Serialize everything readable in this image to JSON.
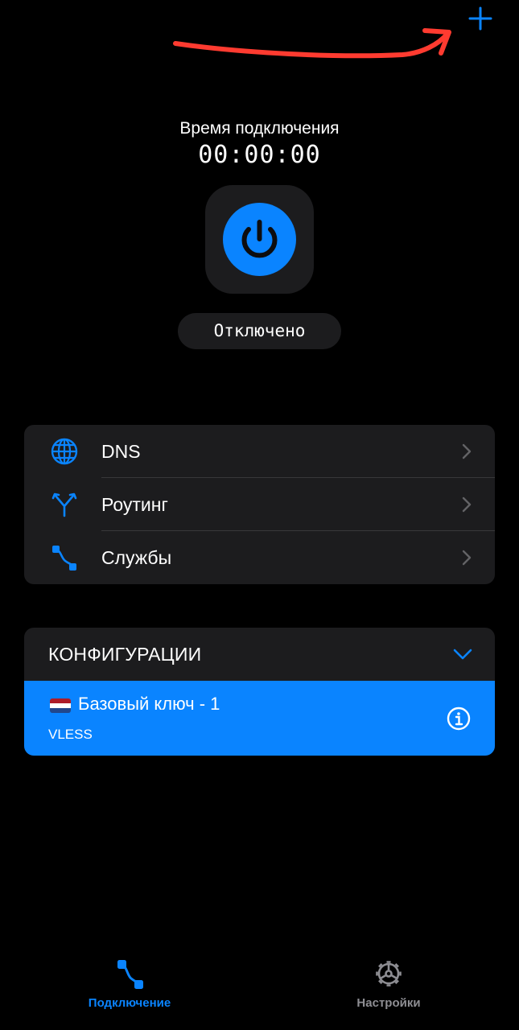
{
  "toolbar": {
    "add_icon": "plus-icon"
  },
  "connection": {
    "timer_label": "Время подключения",
    "timer_value": "00:00:00",
    "power_icon": "power-icon",
    "status": "Отключено"
  },
  "menu": {
    "items": [
      {
        "label": "DNS",
        "icon": "globe-icon"
      },
      {
        "label": "Роутинг",
        "icon": "routing-fork-icon"
      },
      {
        "label": "Службы",
        "icon": "services-node-icon"
      }
    ]
  },
  "configs": {
    "title": "КОНФИГУРАЦИИ",
    "items": [
      {
        "name": "Базовый ключ - 1",
        "protocol": "VLESS",
        "flag": "netherlands-flag-icon"
      }
    ]
  },
  "tabbar": {
    "tabs": [
      {
        "label": "Подключение",
        "icon": "connection-node-icon",
        "active": true
      },
      {
        "label": "Настройки",
        "icon": "gear-icon",
        "active": false
      }
    ]
  },
  "colors": {
    "accent": "#0a84ff",
    "background": "#000000",
    "card": "#1c1c1e",
    "inactive": "#8e8e93",
    "annotation": "#ff3b30"
  }
}
